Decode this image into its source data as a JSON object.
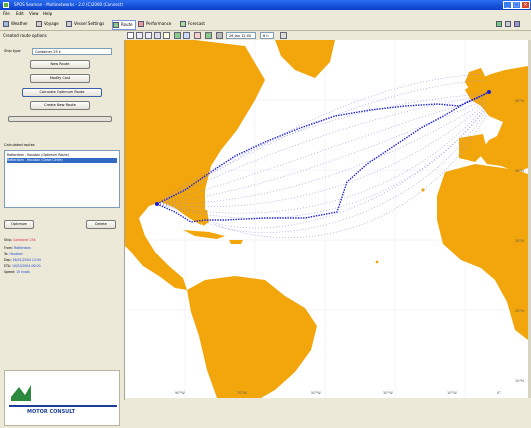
{
  "window": {
    "title": "SPOS Seaman - Multinetworks - 2.0 (C)2000 (Connect)"
  },
  "menu": [
    "File",
    "Edit",
    "View",
    "Help"
  ],
  "toolbar": {
    "buttons": [
      {
        "label": "Weather",
        "icon": "weather-icon"
      },
      {
        "label": "Voyage",
        "icon": "voyage-icon"
      },
      {
        "label": "Vessel Settings",
        "icon": "vessel-icon"
      },
      {
        "label": "Route",
        "icon": "route-icon"
      },
      {
        "label": "Performance",
        "icon": "performance-icon"
      },
      {
        "label": "Forecast",
        "icon": "forecast-icon"
      }
    ],
    "active": "Route"
  },
  "subtoolbar": {
    "label": "Created route options",
    "date_value": "26 Jan 12:00",
    "step_value": "6 h"
  },
  "left_panel": {
    "dropdown_label": "Ship type",
    "dropdown_value": "Container 25 k",
    "buttons": [
      "New Route",
      "Modify Cost",
      "Calculate Optimum Route",
      "Create New Route"
    ],
    "calculated_routes_label": "Calculated routes",
    "routes": [
      "Rotterdam - Houston (Optimum Route)",
      "Rotterdam - Houston (Great Circle)"
    ],
    "action_buttons": [
      "Optimize",
      "Delete"
    ],
    "info": [
      {
        "key": "Ship:",
        "value": "Container 25k"
      },
      {
        "key": "From:",
        "value": "Rotterdam"
      },
      {
        "key": "To:",
        "value": "Houston"
      },
      {
        "key": "Dep:",
        "value": "26/01/2004 12:00"
      },
      {
        "key": "ETA:",
        "value": "10/02/2004 06:00"
      },
      {
        "key": "Speed:",
        "value": "15 knots"
      }
    ],
    "logo_text": "MOTOR CONSULT"
  },
  "map": {
    "land_color": "#f3a60c",
    "route_color": "#1a20d0",
    "lon_labels": [
      "90°W",
      "70°W",
      "50°W",
      "30°W",
      "10°W",
      "0°"
    ],
    "lat_labels": [
      "50°N",
      "40°N",
      "30°N",
      "20°N",
      "10°N"
    ]
  }
}
